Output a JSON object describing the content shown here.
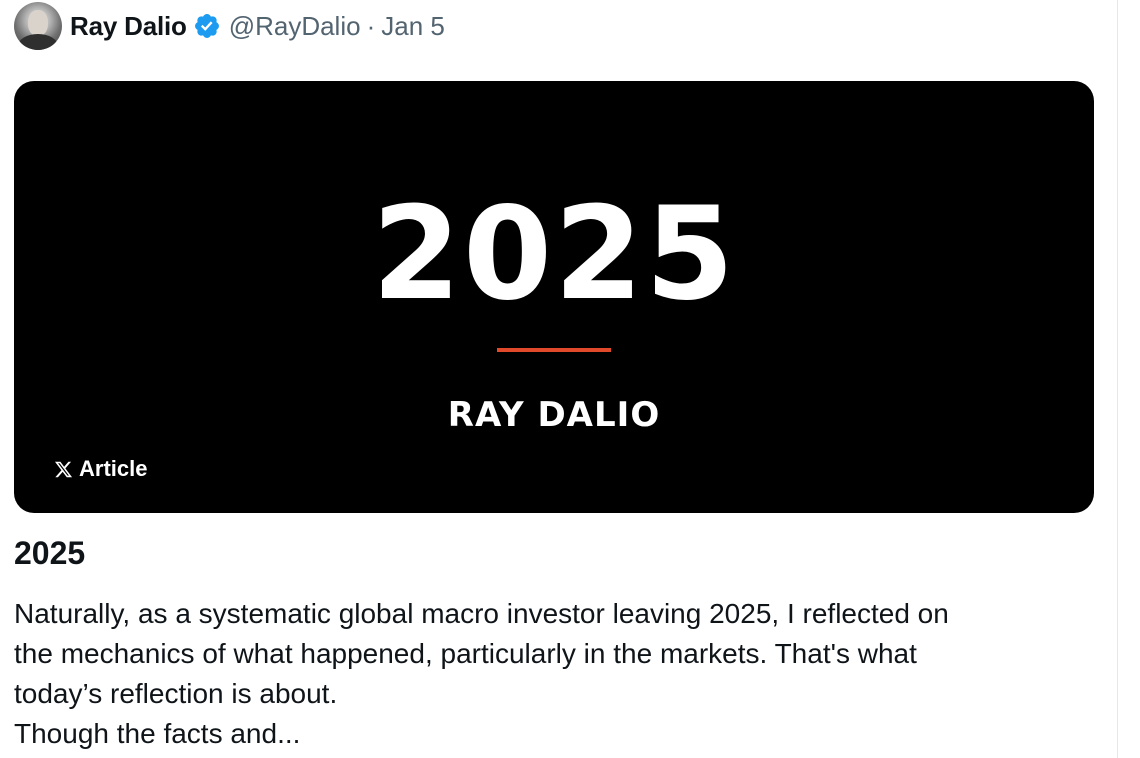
{
  "tweet": {
    "author": {
      "display_name": "Ray Dalio",
      "verified": true,
      "handle": "@RayDalio",
      "separator": "·",
      "date": "Jan 5"
    },
    "card": {
      "headline": "2025",
      "author": "RAY DALIO",
      "badge_label": "Article",
      "accent_color": "#e0492a"
    },
    "article": {
      "title": "2025",
      "body_lines": [
        "Naturally, as a systematic global macro investor leaving 2025, I reflected on",
        "the mechanics of what happened, particularly in the markets. That's what",
        "today’s reflection is about.",
        "Though the facts and..."
      ]
    }
  },
  "icons": {
    "verified": "verified-badge-icon",
    "x_logo": "x-logo-icon"
  },
  "colors": {
    "verified_blue": "#1d9bf0",
    "secondary_text": "#536471"
  }
}
